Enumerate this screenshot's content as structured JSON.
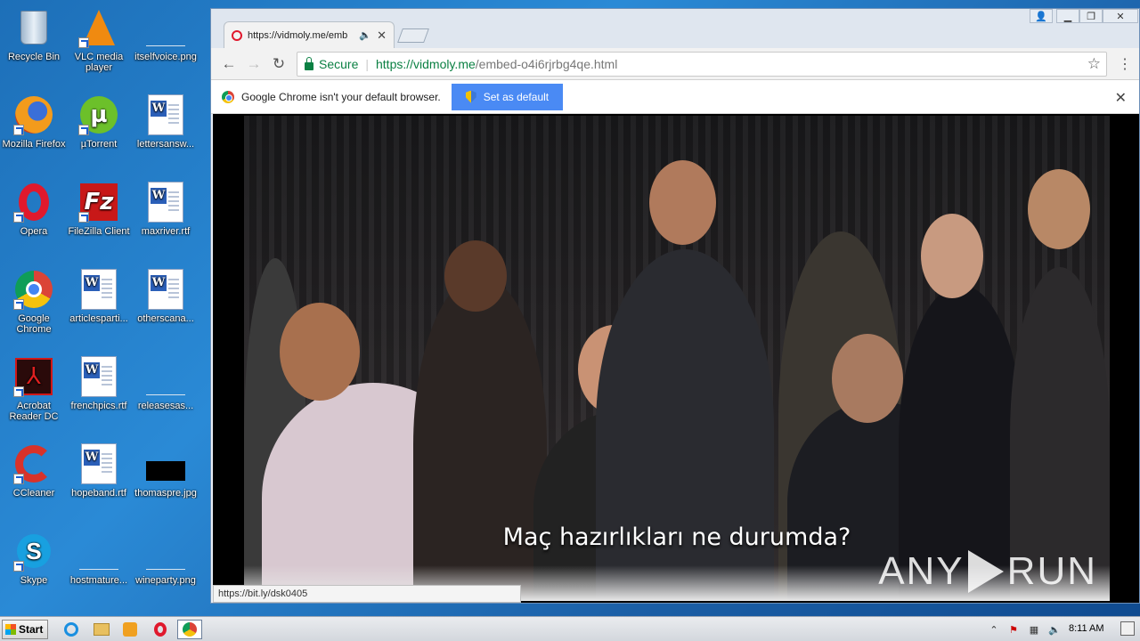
{
  "desktop": {
    "icons": [
      {
        "label": "Recycle Bin"
      },
      {
        "label": "VLC media player"
      },
      {
        "label": "itselfvoice.png"
      },
      {
        "label": "Mozilla Firefox"
      },
      {
        "label": "µTorrent"
      },
      {
        "label": "lettersansw..."
      },
      {
        "label": "Opera"
      },
      {
        "label": "FileZilla Client"
      },
      {
        "label": "maxriver.rtf"
      },
      {
        "label": "Google Chrome"
      },
      {
        "label": "articlesparti..."
      },
      {
        "label": "otherscana..."
      },
      {
        "label": "Acrobat Reader DC"
      },
      {
        "label": "frenchpics.rtf"
      },
      {
        "label": "releasesas..."
      },
      {
        "label": "CCleaner"
      },
      {
        "label": "hopeband.rtf"
      },
      {
        "label": "thomaspre.jpg"
      },
      {
        "label": "Skype"
      },
      {
        "label": "hostmature..."
      },
      {
        "label": "wineparty.png"
      }
    ]
  },
  "browser": {
    "tab_title": "https://vidmoly.me/emb",
    "address": {
      "secure_label": "Secure",
      "url_host": "https://vidmoly.me",
      "url_path": "/embed-o4i6rjrbg4qe.html"
    },
    "infobar": {
      "message": "Google Chrome isn't your default browser.",
      "button_label": "Set as default"
    },
    "video": {
      "subtitle": "Maç hazırlıkları ne durumda?",
      "watermark": "ANY RUN"
    },
    "status_url": "https://bit.ly/dsk0405"
  },
  "taskbar": {
    "start_label": "Start",
    "clock": "8:11 AM"
  }
}
